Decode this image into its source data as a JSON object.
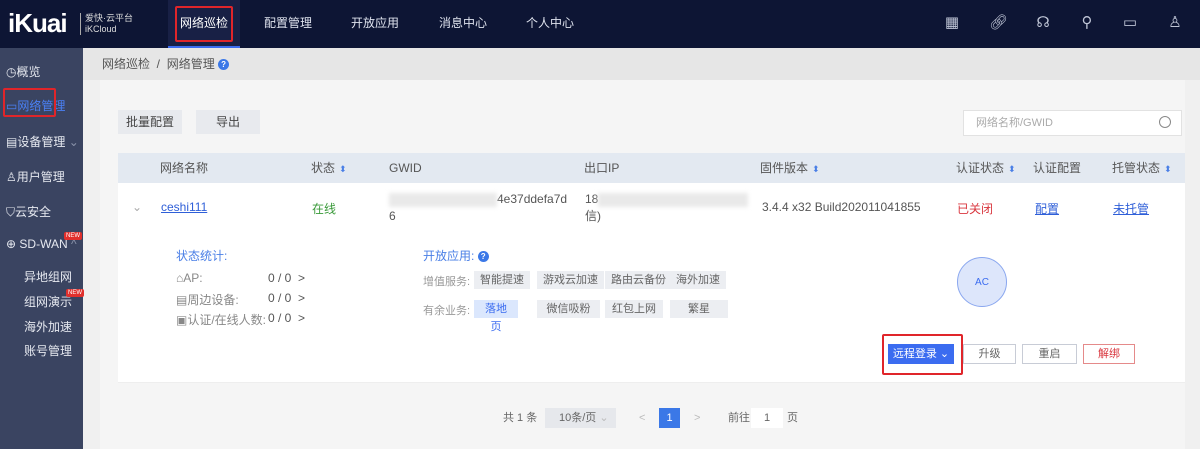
{
  "brand": {
    "logo": "iKuai",
    "name_cn": "爱快·云平台",
    "name_en": "iKCloud"
  },
  "top_nav": [
    "网络巡检",
    "配置管理",
    "开放应用",
    "消息中心",
    "个人中心"
  ],
  "top_icons": [
    "apps-icon",
    "link-icon",
    "headset-icon",
    "tool-icon",
    "message-icon",
    "user-settings-icon"
  ],
  "sidebar": {
    "items": [
      "概览",
      "网络管理",
      "设备管理",
      "用户管理",
      "云安全",
      "SD-WAN"
    ],
    "sub_items": [
      "异地组网",
      "组网演示",
      "海外加速",
      "账号管理"
    ],
    "badge": "NEW"
  },
  "breadcrumb": {
    "parent": "网络巡检",
    "current": "网络管理",
    "help": "?"
  },
  "toolbar": {
    "batch": "批量配置",
    "export": "导出",
    "search_placeholder": "网络名称/GWID"
  },
  "table": {
    "headers": [
      "网络名称",
      "状态",
      "GWID",
      "出口IP",
      "固件版本",
      "认证状态",
      "认证配置",
      "托管状态"
    ],
    "row": {
      "name": "ceshi111",
      "status": "在线",
      "gwid_line1": "4e37ddefa7d",
      "gwid_line2": "6",
      "ip_line1": "18",
      "ip_line2": "信)",
      "firmware": "3.4.4 x32 Build202011041855",
      "auth_status": "已关闭",
      "auth_config": "配置",
      "hosting": "未托管"
    }
  },
  "detail": {
    "stats_title": "状态统计:",
    "stats": [
      {
        "label": "AP:",
        "value": "0 / 0",
        "arrow": ">"
      },
      {
        "label": "周边设备:",
        "value": "0 / 0",
        "arrow": ">"
      },
      {
        "label": "认证/在线人数:",
        "value": "0 / 0",
        "arrow": ">"
      }
    ],
    "apps_title": "开放应用:",
    "value_added_label": "增值服务:",
    "value_added": [
      "智能提速",
      "游戏云加速",
      "路由云备份",
      "海外加速"
    ],
    "surplus_label": "有余业务:",
    "surplus": [
      "落地页",
      "微信吸粉",
      "红包上网",
      "繁星"
    ],
    "ac_label": "AC",
    "actions": {
      "remote": "远程登录",
      "upgrade": "升级",
      "reboot": "重启",
      "unbind": "解绑"
    }
  },
  "pagination": {
    "total": "共 1 条",
    "page_size": "10条/页",
    "current": "1",
    "goto_label": "前往",
    "goto_value": "1",
    "page_suffix": "页",
    "prev": "<",
    "next": ">"
  }
}
